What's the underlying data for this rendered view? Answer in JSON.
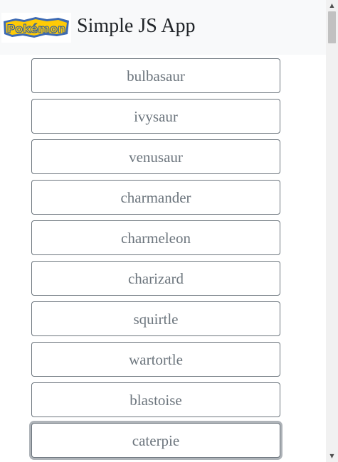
{
  "header": {
    "logo_text": "Pokémon",
    "title": "Simple JS App"
  },
  "pokemon_list": [
    {
      "name": "bulbasaur"
    },
    {
      "name": "ivysaur"
    },
    {
      "name": "venusaur"
    },
    {
      "name": "charmander"
    },
    {
      "name": "charmeleon"
    },
    {
      "name": "charizard"
    },
    {
      "name": "squirtle"
    },
    {
      "name": "wartortle"
    },
    {
      "name": "blastoise"
    },
    {
      "name": "caterpie"
    }
  ],
  "scrollbar": {
    "up_icon": "chevron-up-icon",
    "down_icon": "chevron-down-icon"
  },
  "colors": {
    "navbar_bg": "#f8f9fa",
    "button_border": "#6c757d",
    "button_text": "#6c757d",
    "logo_yellow": "#ffcb05",
    "logo_blue": "#3d6ab3"
  }
}
